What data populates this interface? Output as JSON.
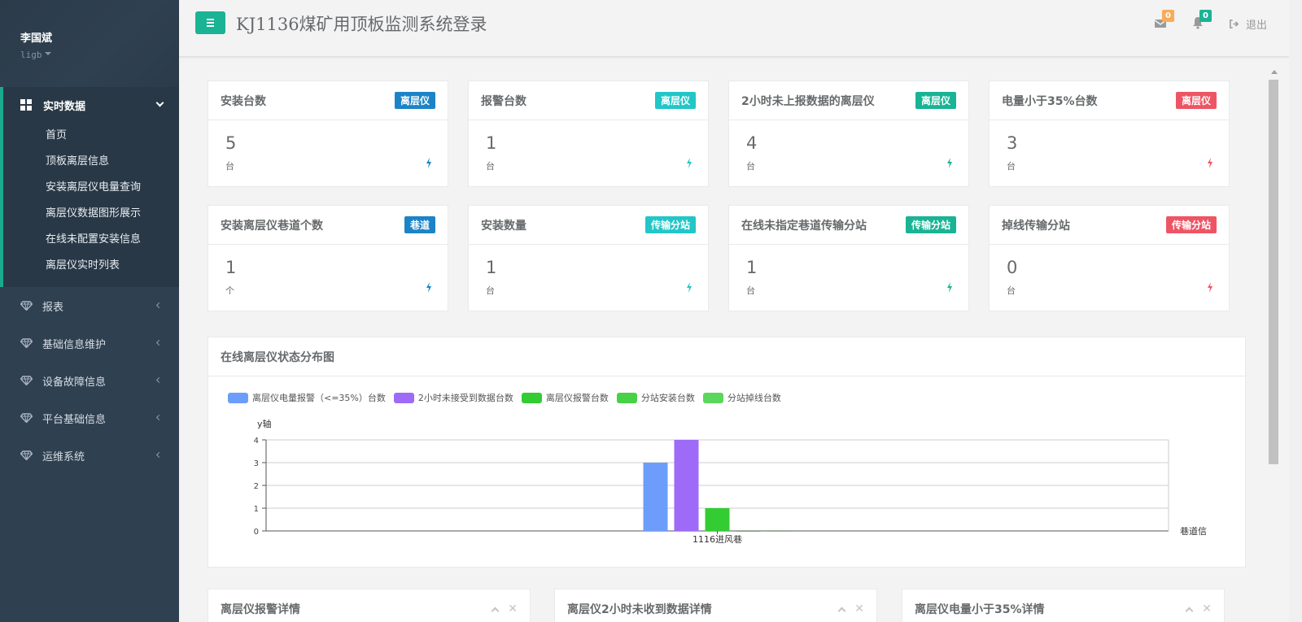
{
  "sidebar": {
    "user_name": "李国斌",
    "user_login": "ligb",
    "active_group": {
      "label": "实时数据",
      "icon": "grid-icon"
    },
    "sub_items": [
      "首页",
      "顶板离层信息",
      "安装离层仪电量查询",
      "离层仪数据图形展示",
      "在线未配置安装信息",
      "离层仪实时列表"
    ],
    "groups": [
      {
        "label": "报表",
        "icon": "diamond-icon"
      },
      {
        "label": "基础信息维护",
        "icon": "diamond-icon"
      },
      {
        "label": "设备故障信息",
        "icon": "diamond-icon"
      },
      {
        "label": "平台基础信息",
        "icon": "diamond-icon"
      },
      {
        "label": "运维系统",
        "icon": "diamond-icon"
      }
    ]
  },
  "header": {
    "title": "KJ1136煤矿用顶板监测系统登录",
    "mail_count": "0",
    "bell_count": "0",
    "logout_label": "退出",
    "colors": {
      "accent": "#1ab394",
      "mail_badge": "#f8ac59",
      "bell_badge": "#1ab394"
    }
  },
  "cards": [
    {
      "title": "安装台数",
      "label": "离层仪",
      "value": "5",
      "unit": "台",
      "color": "#1c84c6"
    },
    {
      "title": "报警台数",
      "label": "离层仪",
      "value": "1",
      "unit": "台",
      "color": "#23c6c8"
    },
    {
      "title": "2小时未上报数据的离层仪",
      "label": "离层仪",
      "value": "4",
      "unit": "台",
      "color": "#1ab394"
    },
    {
      "title": "电量小于35%台数",
      "label": "离层仪",
      "value": "3",
      "unit": "台",
      "color": "#ed5565"
    },
    {
      "title": "安装离层仪巷道个数",
      "label": "巷道",
      "value": "1",
      "unit": "个",
      "color": "#1c84c6"
    },
    {
      "title": "安装数量",
      "label": "传输分站",
      "value": "1",
      "unit": "台",
      "color": "#23c6c8"
    },
    {
      "title": "在线未指定巷道传输分站",
      "label": "传输分站",
      "value": "1",
      "unit": "台",
      "color": "#1ab394"
    },
    {
      "title": "掉线传输分站",
      "label": "传输分站",
      "value": "0",
      "unit": "台",
      "color": "#ed5565"
    }
  ],
  "chart_panel": {
    "title": "在线离层仪状态分布图"
  },
  "chart_data": {
    "type": "bar",
    "categories": [
      "1116进风巷"
    ],
    "series": [
      {
        "name": "离层仪电量报警（<=35%）台数",
        "values": [
          3
        ],
        "color": "#6c9dfb"
      },
      {
        "name": "2小时未接受到数据台数",
        "values": [
          4
        ],
        "color": "#9d6bf8"
      },
      {
        "name": "离层仪报警台数",
        "values": [
          1
        ],
        "color": "#33cc33"
      },
      {
        "name": "分站安装台数",
        "values": [
          0
        ],
        "color": "#47d147"
      },
      {
        "name": "分站掉线台数",
        "values": [
          0
        ],
        "color": "#5cd65c"
      }
    ],
    "xlabel": "巷道信",
    "ylabel": "y轴",
    "ylim": [
      0,
      4
    ],
    "yticks": [
      "0",
      "1",
      "2",
      "3",
      "4"
    ],
    "grid": true,
    "legend": "top-left"
  },
  "bottom_panels": [
    {
      "title": "离层仪报警详情"
    },
    {
      "title": "离层仪2小时未收到数据详情"
    },
    {
      "title": "离层仪电量小于35%详情"
    }
  ]
}
